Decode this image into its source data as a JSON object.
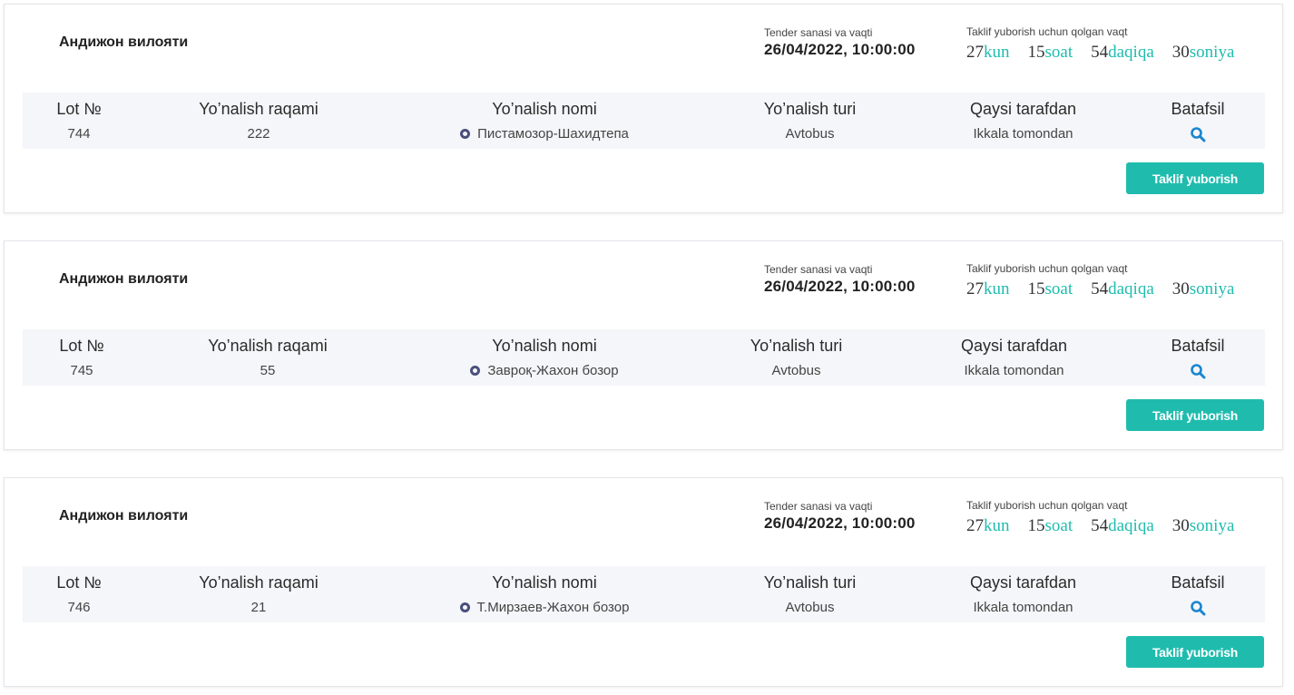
{
  "colors": {
    "accent": "#1fbcae",
    "ring": "#4a4f7a",
    "table_bg": "#f5f6f9"
  },
  "labels": {
    "tender": "Tender sanasi va vaqti",
    "remaining": "Taklif yuborish uchun qolgan vaqt",
    "units": {
      "days": "kun",
      "hours": "soat",
      "minutes": "daqiqa",
      "seconds": "soniya"
    },
    "columns": [
      "Lot №",
      "Yo’nalish raqami",
      "Yo’nalish nomi",
      "Yo’nalish turi",
      "Qaysi tarafdan",
      "Batafsil"
    ],
    "button": "Taklif yuborish"
  },
  "icons": {
    "route_marker": "ring-icon",
    "details": "search-icon"
  },
  "cards": [
    {
      "region": "Андижон вилояти",
      "tender_date": "26/04/2022, 10:00:00",
      "countdown": {
        "days": "27",
        "hours": "15",
        "minutes": "54",
        "seconds": "30"
      },
      "lot": "744",
      "route_number": "222",
      "route_name": "Пистамозор-Шахидтепа",
      "route_type": "Avtobus",
      "direction": "Ikkala tomondan"
    },
    {
      "region": "Андижон вилояти",
      "tender_date": "26/04/2022, 10:00:00",
      "countdown": {
        "days": "27",
        "hours": "15",
        "minutes": "54",
        "seconds": "30"
      },
      "lot": "745",
      "route_number": "55",
      "route_name": "Завроқ-Жахон бозор",
      "route_type": "Avtobus",
      "direction": "Ikkala tomondan"
    },
    {
      "region": "Андижон вилояти",
      "tender_date": "26/04/2022, 10:00:00",
      "countdown": {
        "days": "27",
        "hours": "15",
        "minutes": "54",
        "seconds": "30"
      },
      "lot": "746",
      "route_number": "21",
      "route_name": "Т.Мирзаев-Жахон бозор",
      "route_type": "Avtobus",
      "direction": "Ikkala tomondan"
    }
  ]
}
